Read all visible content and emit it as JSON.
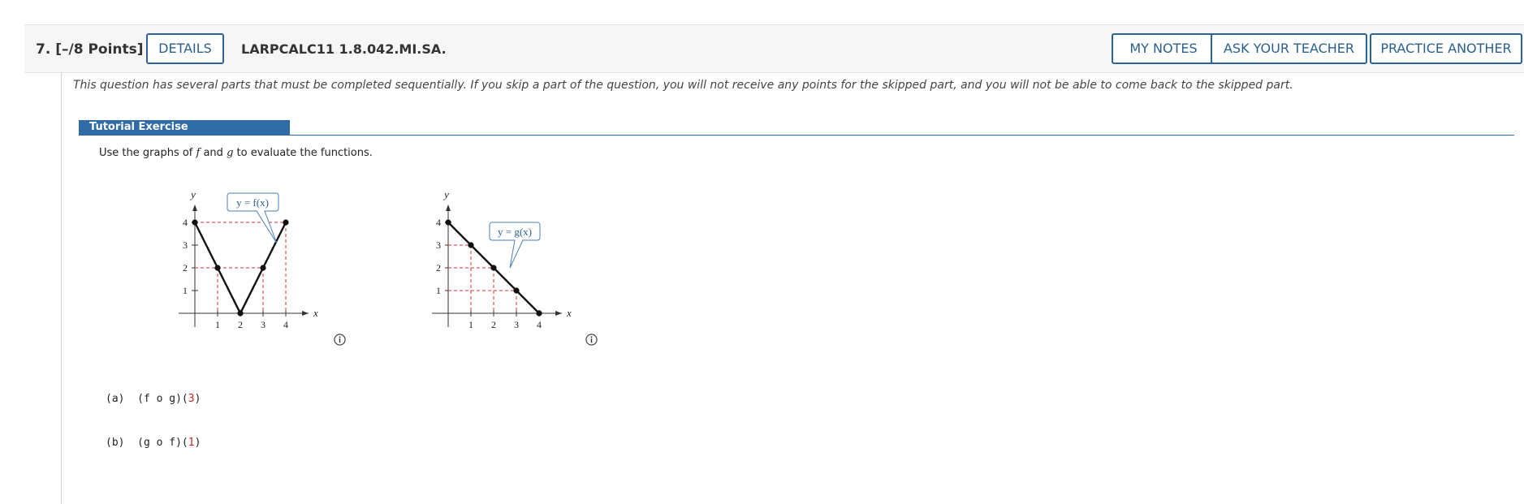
{
  "question": {
    "number": "7.",
    "points": "[–/8 Points]",
    "details_label": "DETAILS",
    "code": "LARPCALC11 1.8.042.MI.SA.",
    "my_notes_label": "MY NOTES",
    "ask_teacher_label": "ASK YOUR TEACHER",
    "practice_label": "PRACTICE ANOTHER"
  },
  "notice": "This question has several parts that must be completed sequentially. If you skip a part of the question, you will not receive any points for the skipped part, and you will not be able to come back to the skipped part.",
  "tutorial": {
    "tab_label": "Tutorial Exercise",
    "instr_pre": "Use the graphs of ",
    "instr_f": "f",
    "instr_mid": " and ",
    "instr_g": "g",
    "instr_post": " to evaluate the functions."
  },
  "graph_f": {
    "callout": "y = f(x)",
    "y_label": "y",
    "x_label": "x",
    "points": [
      [
        0,
        4
      ],
      [
        1,
        2
      ],
      [
        2,
        0
      ],
      [
        3,
        2
      ],
      [
        4,
        4
      ]
    ],
    "x_ticks": [
      "1",
      "2",
      "3",
      "4"
    ],
    "y_ticks": [
      "1",
      "2",
      "3",
      "4"
    ]
  },
  "graph_g": {
    "callout": "y = g(x)",
    "y_label": "y",
    "x_label": "x",
    "points": [
      [
        0,
        4
      ],
      [
        1,
        3
      ],
      [
        2,
        2
      ],
      [
        3,
        1
      ],
      [
        4,
        0
      ]
    ],
    "x_ticks": [
      "1",
      "2",
      "3",
      "4"
    ],
    "y_ticks": [
      "1",
      "2",
      "3",
      "4"
    ]
  },
  "parts": {
    "a_label": "(a)",
    "a_expr": "(f o g)(",
    "a_arg": "3",
    "a_close": ")",
    "b_label": "(b)",
    "b_expr": "(g o f)(",
    "b_arg": "1",
    "b_close": ")"
  },
  "icons": {
    "info": "info-circle-icon"
  },
  "colors": {
    "accent": "#2a6496",
    "tab": "#2f6ba6",
    "dash": "#d9302c",
    "arg": "#cc2222"
  }
}
